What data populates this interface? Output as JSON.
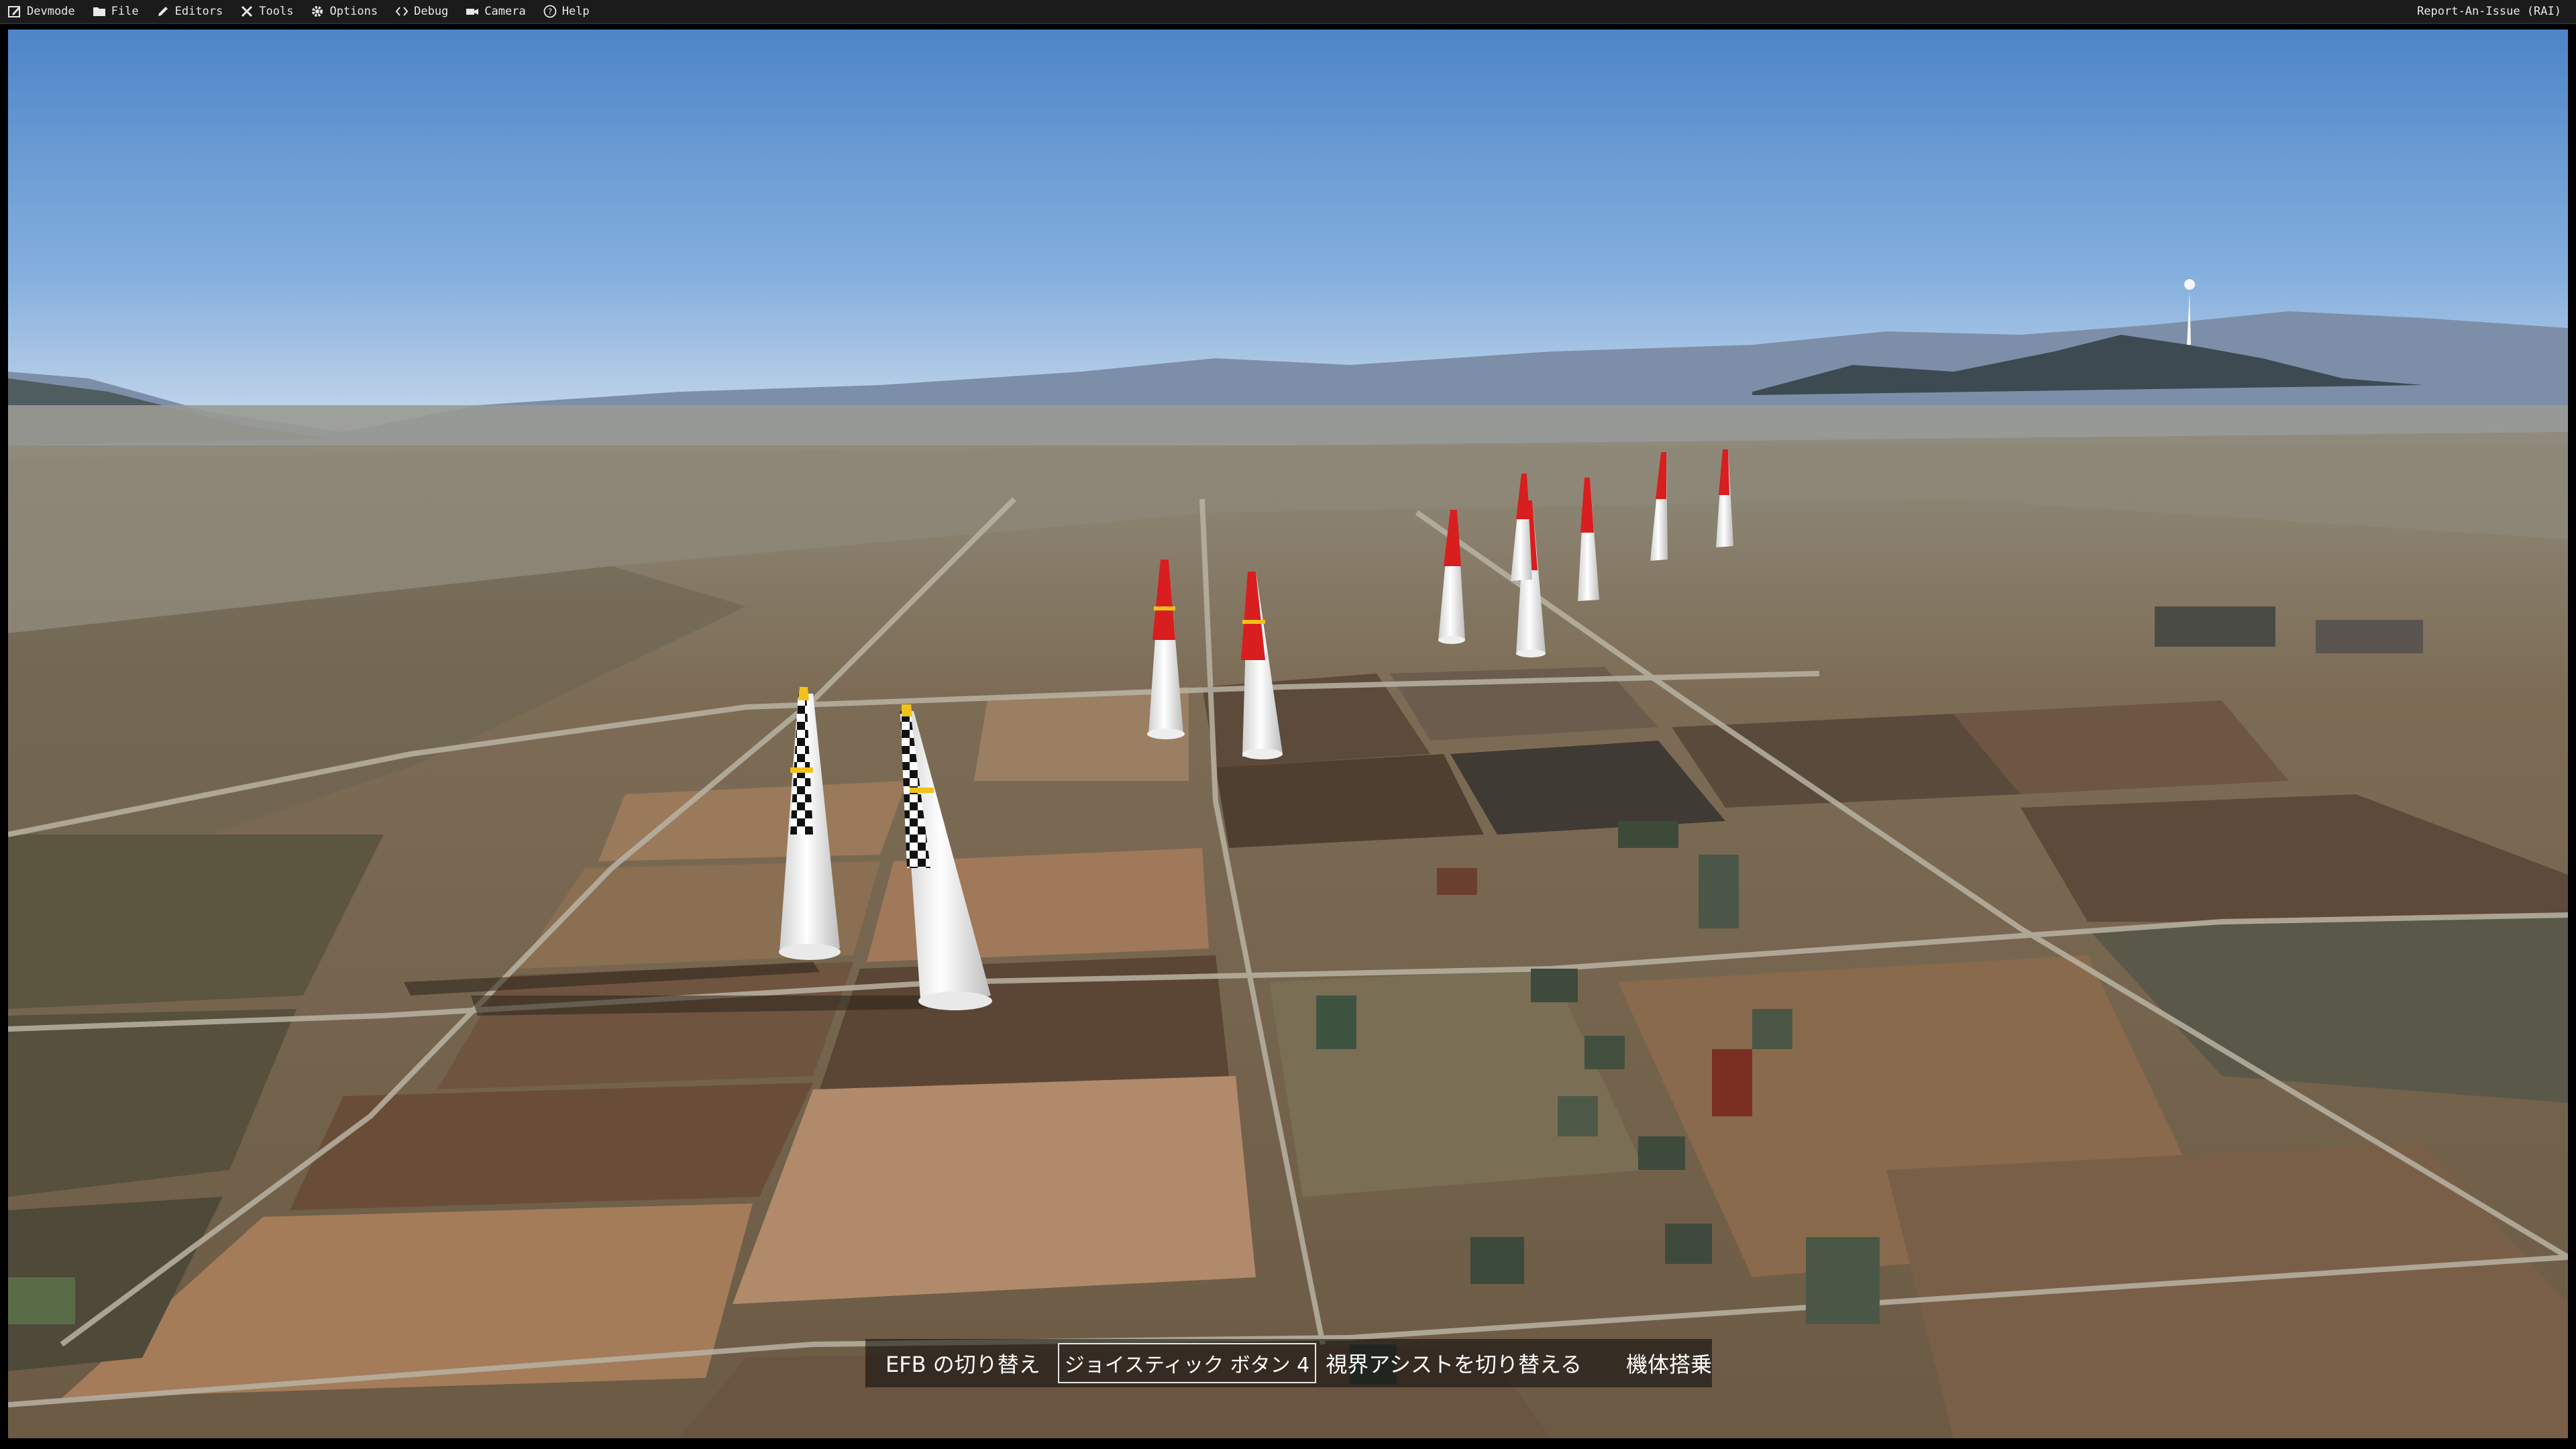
{
  "menubar": {
    "items": [
      {
        "label": "Devmode",
        "icon": "devmode-icon"
      },
      {
        "label": "File",
        "icon": "folder-icon"
      },
      {
        "label": "Editors",
        "icon": "pencil-icon"
      },
      {
        "label": "Tools",
        "icon": "tools-icon"
      },
      {
        "label": "Options",
        "icon": "gear-icon"
      },
      {
        "label": "Debug",
        "icon": "code-icon"
      },
      {
        "label": "Camera",
        "icon": "camera-icon"
      },
      {
        "label": "Help",
        "icon": "help-icon"
      }
    ],
    "report": "Report-An-Issue (RAI)"
  },
  "hints": {
    "efb": "EFB の切り替え",
    "joystick": "ジョイスティック ボタン 4",
    "assist": "視界アシストを切り替える",
    "board": "機体搭乗"
  },
  "colors": {
    "menubar_bg": "#1b1b1b",
    "sky_top": "#4f86c9",
    "sky_horizon": "#c9dbee",
    "pylon_red": "#d81e1e",
    "pylon_yellow": "#f2c21a"
  }
}
